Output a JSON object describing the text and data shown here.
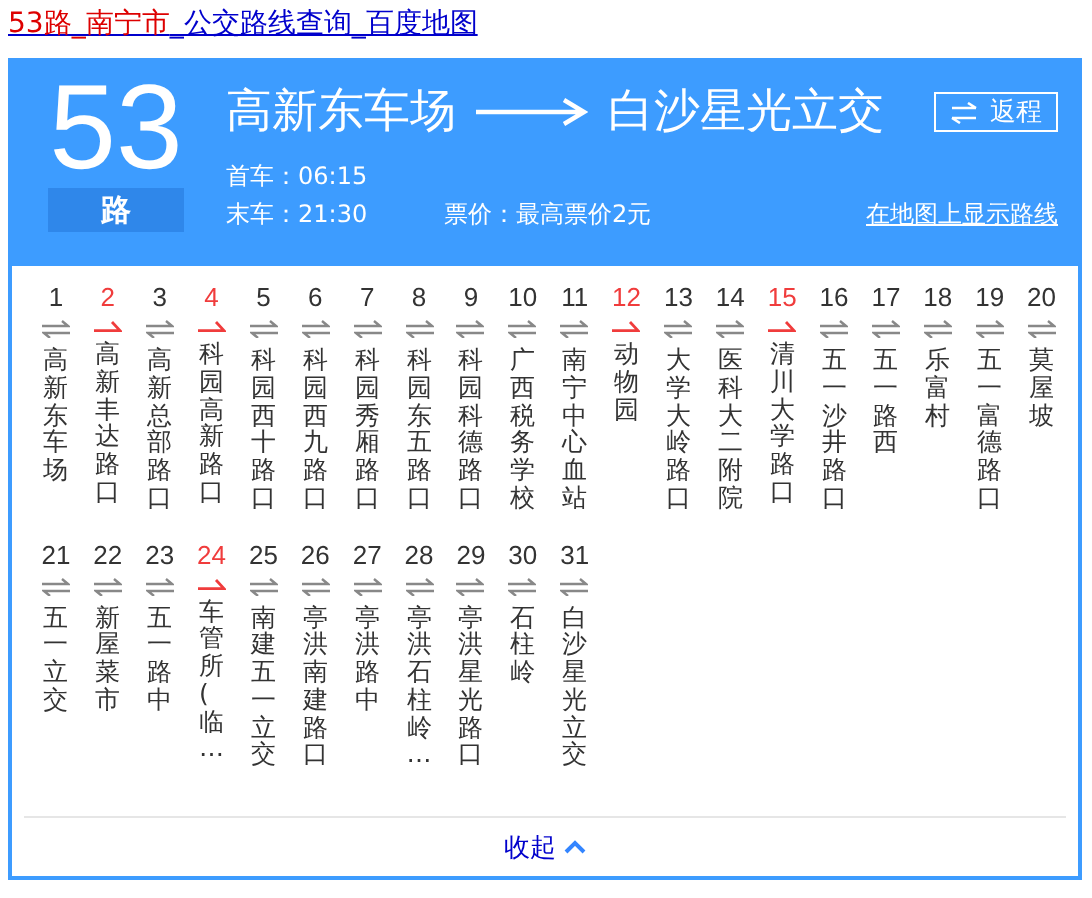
{
  "page_title": [
    {
      "text": "53路_南宁市",
      "highlight": true
    },
    {
      "text": "_公交路线查询_百度地图",
      "highlight": false
    }
  ],
  "route": {
    "number": "53",
    "suffix": "路",
    "from": "高新东车场",
    "to": "白沙星光立交",
    "return_button": "返程",
    "first_bus": "首车：06:15",
    "last_bus": "末车：21:30",
    "fare": "票价：最高票价2元",
    "map_link": "在地图上显示路线"
  },
  "stops": [
    {
      "number": "1",
      "name": "高新东车场",
      "one_way": false
    },
    {
      "number": "2",
      "name": "高新丰达路口",
      "one_way": true
    },
    {
      "number": "3",
      "name": "高新总部路口",
      "one_way": false
    },
    {
      "number": "4",
      "name": "科园高新路口",
      "one_way": true
    },
    {
      "number": "5",
      "name": "科园西十路口",
      "one_way": false
    },
    {
      "number": "6",
      "name": "科园西九路口",
      "one_way": false
    },
    {
      "number": "7",
      "name": "科园秀厢路口",
      "one_way": false
    },
    {
      "number": "8",
      "name": "科园东五路口",
      "one_way": false
    },
    {
      "number": "9",
      "name": "科园科德路口",
      "one_way": false
    },
    {
      "number": "10",
      "name": "广西税务学校",
      "one_way": false
    },
    {
      "number": "11",
      "name": "南宁中心血站",
      "one_way": false
    },
    {
      "number": "12",
      "name": "动物园",
      "one_way": true
    },
    {
      "number": "13",
      "name": "大学大岭路口",
      "one_way": false
    },
    {
      "number": "14",
      "name": "医科大二附院",
      "one_way": false
    },
    {
      "number": "15",
      "name": "清川大学路口",
      "one_way": true
    },
    {
      "number": "16",
      "name": "五一沙井路口",
      "one_way": false
    },
    {
      "number": "17",
      "name": "五一路西",
      "one_way": false
    },
    {
      "number": "18",
      "name": "乐富村",
      "one_way": false
    },
    {
      "number": "19",
      "name": "五一富德路口",
      "one_way": false
    },
    {
      "number": "20",
      "name": "莫屋坡",
      "one_way": false
    },
    {
      "number": "21",
      "name": "五一立交",
      "one_way": false
    },
    {
      "number": "22",
      "name": "新屋菜市",
      "one_way": false
    },
    {
      "number": "23",
      "name": "五一路中",
      "one_way": false
    },
    {
      "number": "24",
      "name": "车管所(临…",
      "one_way": true
    },
    {
      "number": "25",
      "name": "南建五一立交",
      "one_way": false
    },
    {
      "number": "26",
      "name": "亭洪南建路口",
      "one_way": false
    },
    {
      "number": "27",
      "name": "亭洪路中",
      "one_way": false
    },
    {
      "number": "28",
      "name": "亭洪石柱岭…",
      "one_way": false
    },
    {
      "number": "29",
      "name": "亭洪星光路口",
      "one_way": false
    },
    {
      "number": "30",
      "name": "石柱岭",
      "one_way": false
    },
    {
      "number": "31",
      "name": "白沙星光立交",
      "one_way": false
    }
  ],
  "collapse_link": "收起"
}
